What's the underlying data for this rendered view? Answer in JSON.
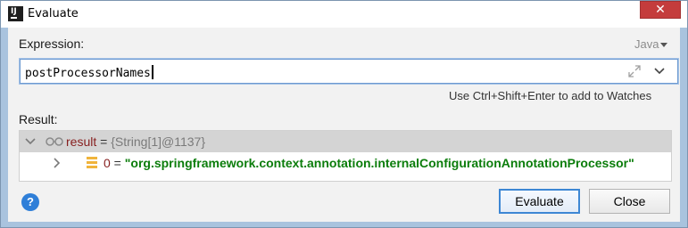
{
  "window": {
    "app_icon_label": "IJ",
    "title": "Evaluate",
    "close_symbol": "✕"
  },
  "expression": {
    "label": "Expression:",
    "language": "Java",
    "value": "postProcessorNames",
    "hint": "Use Ctrl+Shift+Enter to add to Watches"
  },
  "result": {
    "label": "Result:",
    "rows": [
      {
        "name": "result",
        "eq": " = ",
        "type_info": "{String[1]@1137}",
        "expanded": true
      },
      {
        "name": "0",
        "eq": " = ",
        "value": "\"org.springframework.context.annotation.internalConfigurationAnnotationProcessor\"",
        "expanded": false
      }
    ]
  },
  "buttons": {
    "help": "?",
    "evaluate": "Evaluate",
    "close": "Close"
  },
  "colors": {
    "accent": "#3d87d4",
    "variable_name": "#871f1f",
    "string_value": "#0b7d0b",
    "help_button": "#2f7fd8"
  }
}
